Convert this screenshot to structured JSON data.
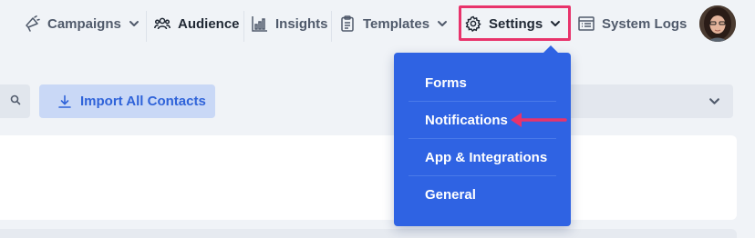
{
  "nav": {
    "campaigns": {
      "label": "Campaigns",
      "icon": "megaphone-icon"
    },
    "audience": {
      "label": "Audience",
      "icon": "people-icon"
    },
    "insights": {
      "label": "Insights",
      "icon": "bar-chart-icon"
    },
    "templates": {
      "label": "Templates",
      "icon": "clipboard-icon"
    },
    "settings": {
      "label": "Settings",
      "icon": "gear-icon"
    },
    "system_logs": {
      "label": "System Logs",
      "icon": "list-icon"
    }
  },
  "toolbar": {
    "import_label": "Import All Contacts",
    "search_icon": "search-icon",
    "download_icon": "download-icon"
  },
  "settings_menu": {
    "items": [
      {
        "label": "Forms"
      },
      {
        "label": "Notifications"
      },
      {
        "label": "App & Integrations"
      },
      {
        "label": "General"
      }
    ]
  },
  "colors": {
    "menu_bg": "#2f63e3",
    "highlight": "#e8336b",
    "import_text": "#2f63d9",
    "import_bg": "#c9d8f6"
  }
}
